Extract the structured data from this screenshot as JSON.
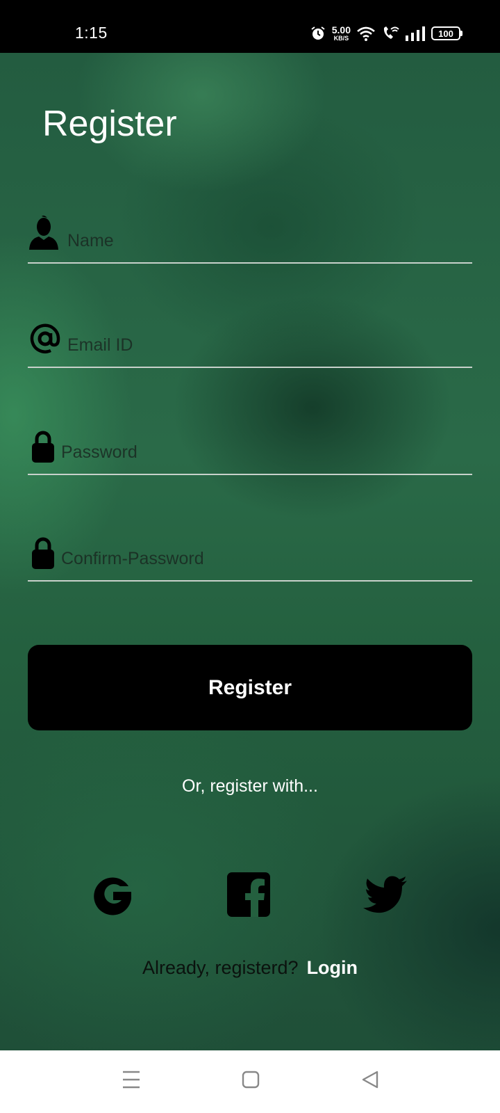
{
  "status_bar": {
    "time": "1:15",
    "net_speed_value": "5.00",
    "net_speed_unit": "KB/S",
    "battery_level": "100",
    "icons": [
      "alarm-icon",
      "wifi-icon",
      "wifi-call-icon",
      "signal-icon",
      "battery-icon"
    ]
  },
  "page": {
    "title": "Register"
  },
  "form": {
    "name_placeholder": "Name",
    "email_placeholder": "Email ID",
    "password_placeholder": "Password",
    "confirm_password_placeholder": "Confirm-Password",
    "submit_label": "Register"
  },
  "social": {
    "prompt": "Or, register with...",
    "providers": [
      "google-icon",
      "facebook-icon",
      "twitter-icon"
    ]
  },
  "footer": {
    "question": "Already, registerd?",
    "login_label": "Login"
  },
  "nav_bar": {
    "buttons": [
      "menu-icon",
      "home-icon",
      "back-icon"
    ]
  },
  "colors": {
    "background": "#24603f",
    "button": "#000000",
    "text_light": "#ffffff",
    "underline": "#c8d1cb"
  }
}
